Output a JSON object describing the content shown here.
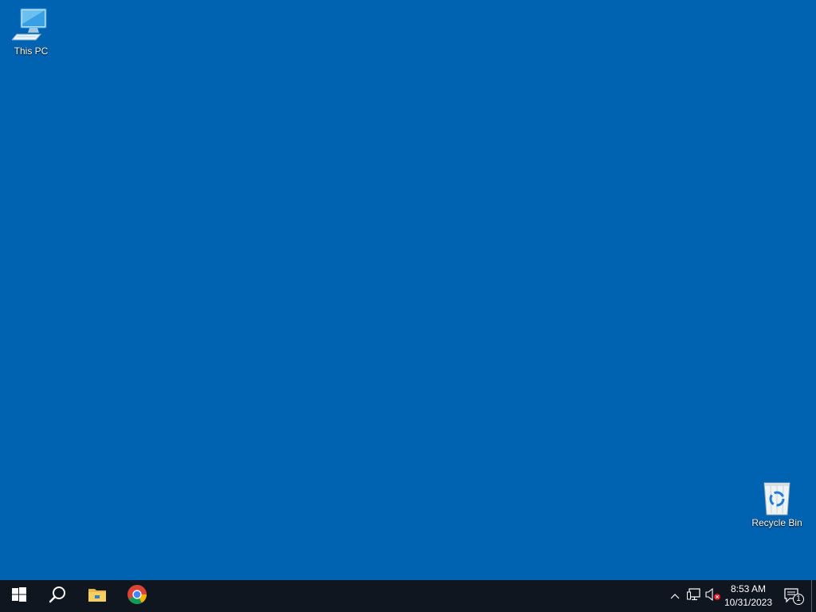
{
  "desktop": {
    "background_color": "#0063b1",
    "icons": [
      {
        "label": "This PC",
        "icon": "computer-icon"
      },
      {
        "label": "Recycle Bin",
        "icon": "recycle-bin-icon"
      }
    ]
  },
  "taskbar": {
    "background_color": "#0f1620",
    "pinned": [
      {
        "icon": "windows-start-icon"
      },
      {
        "icon": "search-icon"
      },
      {
        "icon": "file-explorer-icon"
      },
      {
        "icon": "chrome-icon"
      }
    ],
    "tray": {
      "chevron_icon": "chevron-up-icon",
      "network_icon": "network-icon",
      "volume_icon": "volume-muted-icon",
      "time": "8:53 AM",
      "date": "10/31/2023",
      "notification_icon": "action-center-icon",
      "notification_count": "1"
    }
  }
}
